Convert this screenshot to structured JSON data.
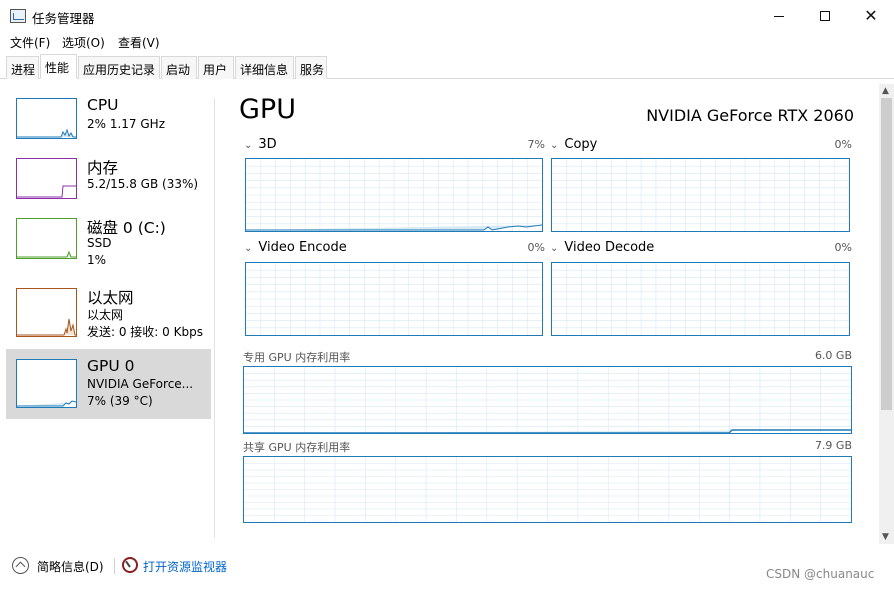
{
  "window": {
    "title": "任务管理器",
    "controls": {
      "minimize": "",
      "maximize": "",
      "close": "✕"
    }
  },
  "menu": [
    "文件(F)",
    "选项(O)",
    "查看(V)"
  ],
  "tabs": [
    "进程",
    "性能",
    "应用历史记录",
    "启动",
    "用户",
    "详细信息",
    "服务"
  ],
  "active_tab": "性能",
  "sidebar": {
    "items": [
      {
        "title": "CPU",
        "lines": [
          "2% 1.17 GHz"
        ],
        "color": "#1e7bb8"
      },
      {
        "title": "内存",
        "lines": [
          "5.2/15.8 GB (33%)"
        ],
        "color": "#8b2fa8"
      },
      {
        "title": "磁盘 0 (C:)",
        "lines": [
          "SSD",
          "1%"
        ],
        "color": "#4f9d2a"
      },
      {
        "title": "以太网",
        "lines": [
          "以太网",
          "发送: 0 接收: 0 Kbps"
        ],
        "color": "#a9561c"
      },
      {
        "title": "GPU 0",
        "lines": [
          "NVIDIA GeForce...",
          "7% (39 °C)"
        ],
        "color": "#1e7bb8"
      }
    ],
    "selected_index": 4
  },
  "main": {
    "title": "GPU",
    "model": "NVIDIA GeForce RTX 2060",
    "engines": [
      {
        "label": "3D",
        "percent": "7%"
      },
      {
        "label": "Copy",
        "percent": "0%"
      },
      {
        "label": "Video Encode",
        "percent": "0%"
      },
      {
        "label": "Video Decode",
        "percent": "0%"
      }
    ],
    "dedicated_memory": {
      "label": "专用 GPU 内存利用率",
      "max": "6.0 GB"
    },
    "shared_memory": {
      "label": "共享 GPU 内存利用率",
      "max": "7.9 GB"
    },
    "graph_color": "#1e7bb8",
    "grid_color": "#d6e9f5"
  },
  "footer": {
    "brief_label": "简略信息(D)",
    "monitor_link": "打开资源监视器",
    "watermark": "CSDN @chuanauc"
  },
  "scrollbar": {
    "up": "▲",
    "down": "▼"
  }
}
